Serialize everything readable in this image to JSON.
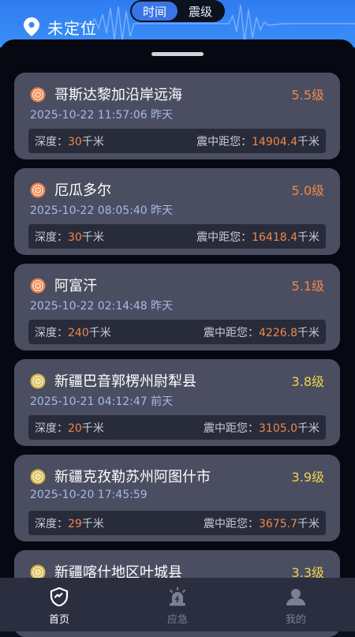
{
  "header": {
    "location": "未定位",
    "tabs": [
      {
        "label": "时间",
        "active": true
      },
      {
        "label": "震级",
        "active": false
      }
    ]
  },
  "colors": {
    "header_blue": "#3b8ff7",
    "magnitude_high": "#f0874b",
    "magnitude_low": "#f1d24c",
    "card_bg": "#4a4e60"
  },
  "list": {
    "depth_label": "深度：",
    "distance_label": "震中距您：",
    "items": [
      {
        "place": "哥斯达黎加沿岸远海",
        "magnitude": "5.5级",
        "time": "2025-10-22 11:57:06 昨天",
        "depth": "30",
        "depth_unit": "千米",
        "distance": "14904.4",
        "distance_unit": "千米",
        "level": "high"
      },
      {
        "place": "厄瓜多尔",
        "magnitude": "5.0级",
        "time": "2025-10-22 08:05:40 昨天",
        "depth": "30",
        "depth_unit": "千米",
        "distance": "16418.4",
        "distance_unit": "千米",
        "level": "high"
      },
      {
        "place": "阿富汗",
        "magnitude": "5.1级",
        "time": "2025-10-22 02:14:48 昨天",
        "depth": "240",
        "depth_unit": "千米",
        "distance": "4226.8",
        "distance_unit": "千米",
        "level": "high"
      },
      {
        "place": "新疆巴音郭楞州尉犁县",
        "magnitude": "3.8级",
        "time": "2025-10-21 04:12:47 前天",
        "depth": "20",
        "depth_unit": "千米",
        "distance": "3105.0",
        "distance_unit": "千米",
        "level": "low"
      },
      {
        "place": "新疆克孜勒苏州阿图什市",
        "magnitude": "3.9级",
        "time": "2025-10-20 17:45:59",
        "depth": "29",
        "depth_unit": "千米",
        "distance": "3675.7",
        "distance_unit": "千米",
        "level": "low"
      },
      {
        "place": "新疆喀什地区叶城县",
        "magnitude": "3.3级",
        "time": "",
        "depth": "",
        "depth_unit": "",
        "distance": "",
        "distance_unit": "",
        "level": "low"
      }
    ]
  },
  "nav": [
    {
      "label": "首页",
      "icon": "shield-home-icon",
      "active": true
    },
    {
      "label": "应急",
      "icon": "alarm-light-icon",
      "active": false
    },
    {
      "label": "我的",
      "icon": "user-icon",
      "active": false
    }
  ]
}
